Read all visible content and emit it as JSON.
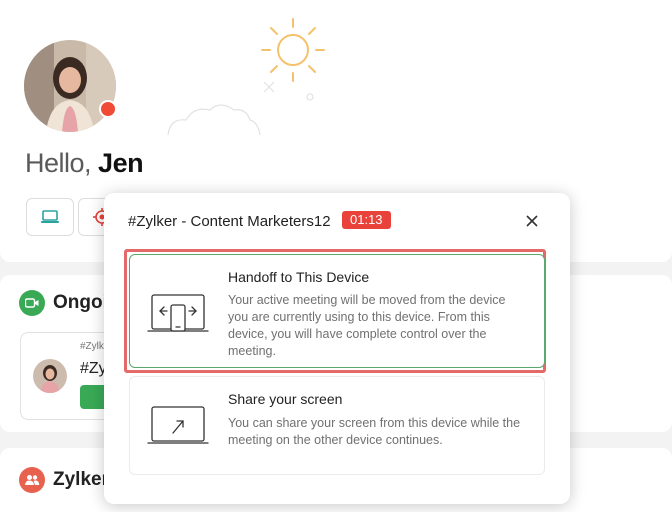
{
  "greeting": {
    "hello": "Hello,",
    "name": "Jen"
  },
  "sections": {
    "ongoing": {
      "title": "Ongoi"
    },
    "zylker": {
      "title": "Zylker"
    }
  },
  "meeting_card": {
    "small_text": "#Zylk",
    "title": "#Zy"
  },
  "modal": {
    "title": "#Zylker - Content Marketers12",
    "timer": "01:13",
    "options": [
      {
        "title": "Handoff to This Device",
        "description": "Your active meeting will be moved from the device you are currently using to this device. From this device, you will have complete control over the meeting."
      },
      {
        "title": "Share your screen",
        "description": "You can share your screen from this device while the meeting on the other device continues."
      }
    ]
  },
  "colors": {
    "accent_green": "#3aa956",
    "alert_red": "#e8423b",
    "highlight": "#e46a6a"
  }
}
